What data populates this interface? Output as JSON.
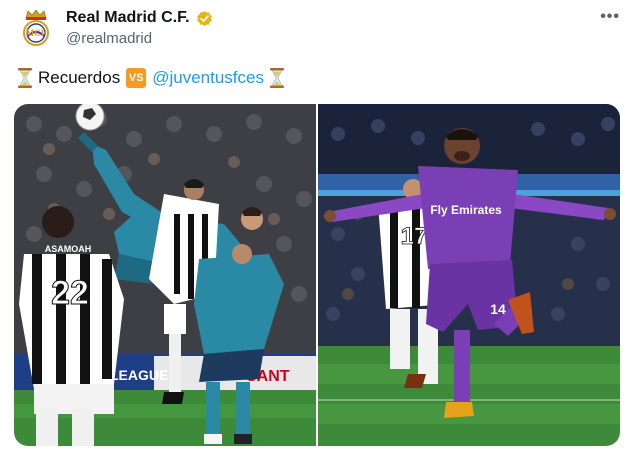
{
  "author": {
    "display_name": "Real Madrid C.F.",
    "handle": "@realmadrid",
    "verified": true,
    "avatar_icon": "real-madrid-crest",
    "verified_icon": "gold-verified-badge"
  },
  "menu": {
    "more_label": "•••"
  },
  "tweet": {
    "lead_icon": "hourglass-icon",
    "word": "Recuerdos",
    "vs_badge": "VS",
    "mention": "@juventusfces",
    "trail_icon": "hourglass-icon"
  },
  "media": {
    "left": {
      "description_icon": "bicycle-kick-photo",
      "shirt_number_foreground": "22",
      "sponsor_partial": "ASAMOAH",
      "board_text_1": "LEAGUE",
      "board_text_2": "SANT"
    },
    "right": {
      "description_icon": "celebration-photo",
      "shirt_number_player": "14",
      "shirt_number_back": "17",
      "sponsor": "Fly Emirates"
    }
  },
  "colors": {
    "verified_gold": "#e2b719",
    "link_blue": "#1d9bf0",
    "vs_orange": "#f59a23",
    "pitch_green": "#3c8a3a",
    "rm_purple": "#7b3fb5"
  }
}
